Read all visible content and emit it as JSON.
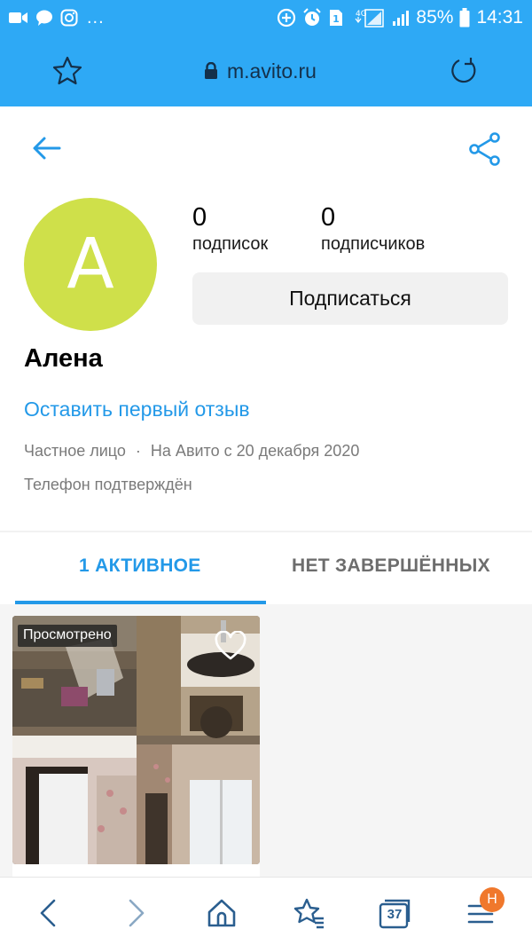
{
  "status_bar": {
    "battery_percent": "85%",
    "time": "14:31",
    "more": "...",
    "sim": "1",
    "network": "4G"
  },
  "browser": {
    "url": "m.avito.ru"
  },
  "profile": {
    "avatar_letter": "A",
    "name": "Алена",
    "subscriptions_count": "0",
    "subscriptions_label": "подписок",
    "subscribers_count": "0",
    "subscribers_label": "подписчиков",
    "subscribe_button": "Подписаться",
    "review_link": "Оставить первый отзыв",
    "seller_type": "Частное лицо",
    "separator": "·",
    "member_since": "На Авито с 20 декабря 2020",
    "phone_status": "Телефон подтверждён",
    "avatar_color": "#cfe04a"
  },
  "tabs": {
    "active": "1 АКТИВНОЕ",
    "completed": "НЕТ ЗАВЕРШЁННЫХ"
  },
  "listing": {
    "badge": "Просмотрено"
  },
  "bottom_nav": {
    "tabs_count": "37",
    "notification_badge": "Н"
  },
  "colors": {
    "accent": "#2399e8",
    "bar": "#2ea9f5",
    "notification": "#f0782c"
  }
}
